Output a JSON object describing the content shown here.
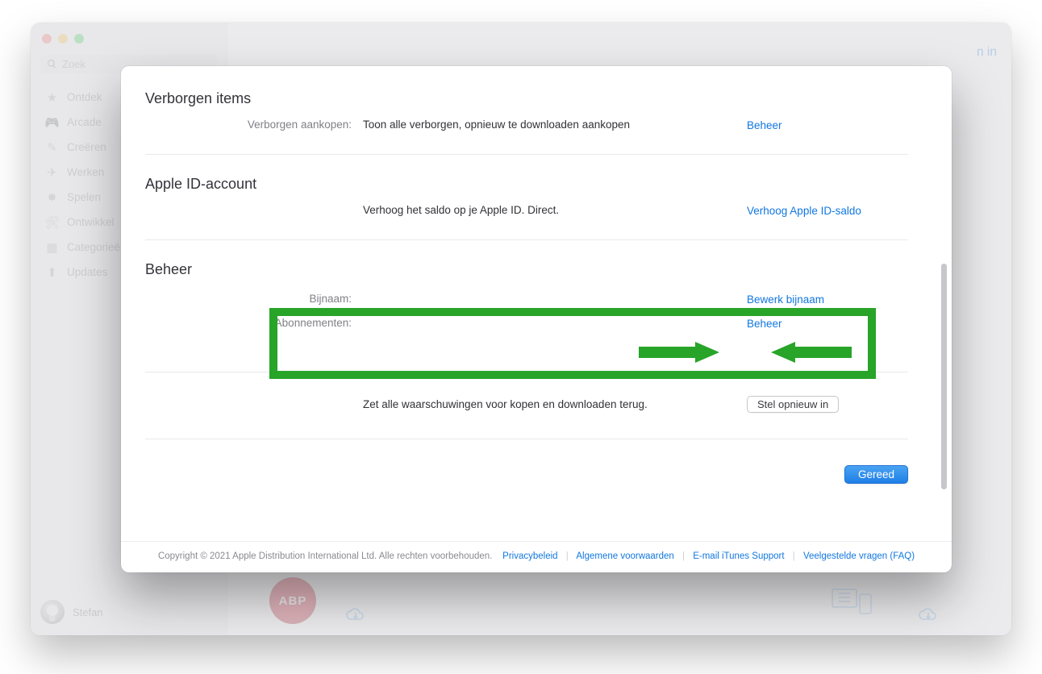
{
  "bg": {
    "search_placeholder": "Zoek",
    "sidebar": [
      {
        "icon": "★",
        "label": "Ontdek"
      },
      {
        "icon": "🎮",
        "label": "Arcade"
      },
      {
        "icon": "✎",
        "label": "Creëren"
      },
      {
        "icon": "✈",
        "label": "Werken"
      },
      {
        "icon": "✸",
        "label": "Spelen"
      },
      {
        "icon": "🛠",
        "label": "Ontwikkel"
      },
      {
        "icon": "▦",
        "label": "Categorieën"
      },
      {
        "icon": "⬆",
        "label": "Updates"
      }
    ],
    "user_name": "Stefan",
    "header_right": "n in",
    "abp_label": "ABP"
  },
  "modal": {
    "sections": {
      "hidden": {
        "title": "Verborgen items",
        "row_label": "Verborgen aankopen:",
        "row_text": "Toon alle verborgen, opnieuw te downloaden aankopen",
        "row_action": "Beheer"
      },
      "appleid": {
        "title": "Apple ID-account",
        "row_text": "Verhoog het saldo op je Apple ID. Direct.",
        "row_action": "Verhoog Apple ID-saldo"
      },
      "manage": {
        "title": "Beheer",
        "nickname_label": "Bijnaam:",
        "nickname_action": "Bewerk bijnaam",
        "subscriptions_label": "Abonnementen:",
        "subscriptions_action": "Beheer"
      },
      "reset": {
        "text": "Zet alle waarschuwingen voor kopen en downloaden terug.",
        "button": "Stel opnieuw in"
      }
    },
    "done_label": "Gereed",
    "footer": {
      "copyright": "Copyright © 2021 Apple Distribution International Ltd. Alle rechten voorbehouden.",
      "privacy": "Privacybeleid",
      "terms": "Algemene voorwaarden",
      "support": "E-mail iTunes Support",
      "faq": "Veelgestelde vragen (FAQ)"
    }
  }
}
